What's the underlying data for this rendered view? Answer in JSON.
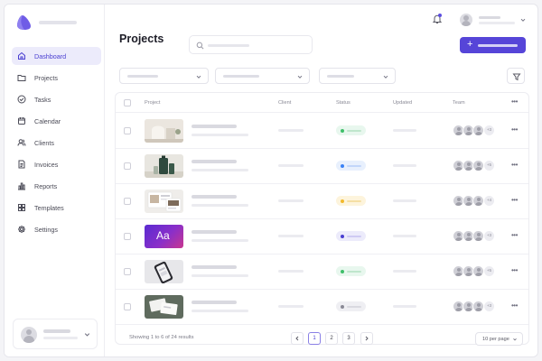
{
  "app": {
    "accent": "#5645d8",
    "logo_icon": "app-logo-icon"
  },
  "sidebar": {
    "items": [
      {
        "label": "Dashboard",
        "icon": "home-icon",
        "active": true
      },
      {
        "label": "Projects",
        "icon": "folder-icon"
      },
      {
        "label": "Tasks",
        "icon": "check-circle-icon"
      },
      {
        "label": "Calendar",
        "icon": "calendar-icon"
      },
      {
        "label": "Clients",
        "icon": "users-icon"
      },
      {
        "label": "Invoices",
        "icon": "invoice-icon"
      },
      {
        "label": "Reports",
        "icon": "bar-chart-icon"
      },
      {
        "label": "Templates",
        "icon": "grid-icon"
      },
      {
        "label": "Settings",
        "icon": "gear-icon"
      }
    ]
  },
  "header": {
    "title": "Projects",
    "new_button_icon": "plus-icon"
  },
  "table": {
    "columns": [
      "Project",
      "Client",
      "Status",
      "Updated",
      "Team"
    ],
    "rows": [
      {
        "thumb": "arch",
        "status": "green",
        "extra": "+3"
      },
      {
        "thumb": "bottle",
        "status": "blue",
        "extra": "+5"
      },
      {
        "thumb": "web",
        "status": "yellow",
        "extra": "+4"
      },
      {
        "thumb": "type",
        "thumb_text": "Aa",
        "status": "purple",
        "extra": "+3"
      },
      {
        "thumb": "phone",
        "status": "green",
        "extra": "+5"
      },
      {
        "thumb": "cards",
        "status": "gray",
        "extra": "+3"
      }
    ],
    "status_colors": {
      "green": {
        "dot": "#3fbf6a",
        "bg": "#e8f7ee",
        "bar": "#bfe6cc"
      },
      "blue": {
        "dot": "#3b82f6",
        "bg": "#e8f0fd",
        "bar": "#c2d6fa"
      },
      "yellow": {
        "dot": "#f2b92c",
        "bg": "#fdf4dc",
        "bar": "#f5dfa4"
      },
      "purple": {
        "dot": "#4a3fd1",
        "bg": "#ecebfb",
        "bar": "#cfcaf3"
      },
      "gray": {
        "dot": "#8a8a96",
        "bg": "#efeff3",
        "bar": "#d9d9e0"
      }
    }
  },
  "footer": {
    "showing": "Showing 1 to 6 of 24 results",
    "pages": [
      "1",
      "2",
      "3"
    ],
    "current_page": "1",
    "per_page": "10 per page"
  }
}
